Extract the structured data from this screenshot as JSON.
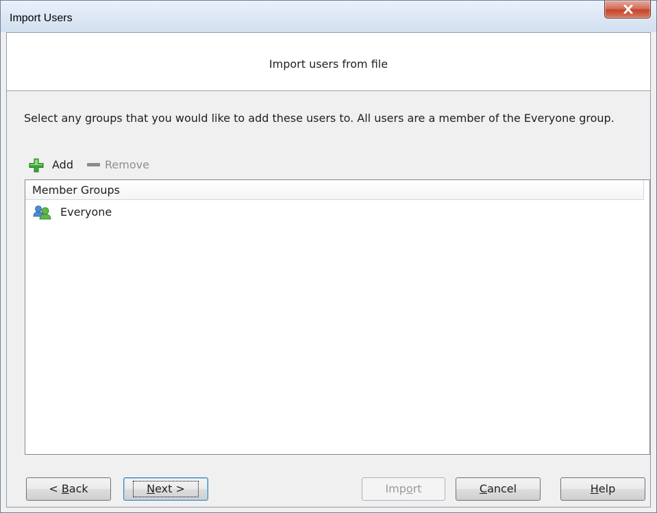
{
  "window": {
    "title": "Import Users",
    "close_icon": "close-x-icon"
  },
  "header": {
    "title": "Import users from file"
  },
  "instruction": "Select any groups that you would like to add these users to.  All users are a member of the Everyone group.",
  "toolbar": {
    "add_label": "Add",
    "add_icon": "green-plus-icon",
    "remove_label": "Remove",
    "remove_icon": "gray-minus-icon",
    "remove_enabled": false
  },
  "groups_list": {
    "column_header": "Member Groups",
    "items": [
      {
        "label": "Everyone",
        "icon": "user-group-icon"
      }
    ]
  },
  "buttons": {
    "back": {
      "prefix": "< ",
      "mnemonic": "B",
      "rest": "ack",
      "enabled": true
    },
    "next": {
      "mnemonic": "N",
      "rest": "ext >",
      "enabled": true,
      "default": true
    },
    "import": {
      "prefix": "Imp",
      "mnemonic": "o",
      "rest": "rt",
      "enabled": false
    },
    "cancel": {
      "mnemonic": "C",
      "rest": "ancel",
      "enabled": true
    },
    "help": {
      "mnemonic": "H",
      "rest": "elp",
      "enabled": true
    }
  },
  "colors": {
    "window_bg": "#f0f0f0",
    "header_bg": "#ffffff",
    "close_button": "#c4452c",
    "add_icon": "#3fa83a",
    "disabled_text": "#9a9a9a"
  }
}
